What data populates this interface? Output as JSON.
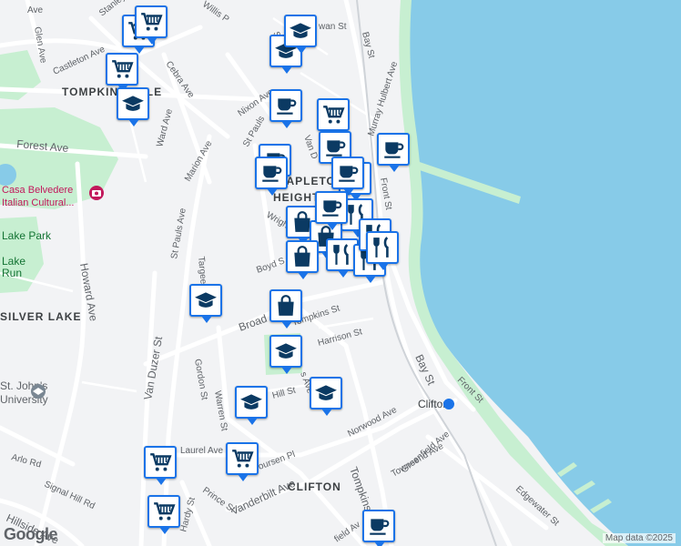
{
  "map": {
    "colors": {
      "water": "#87cbe8",
      "park": "#c7efd1",
      "shore": "#d6f1df",
      "road": "#ffffff",
      "land": "#f2f3f5",
      "marker_border": "#1a73e8",
      "marker_icon": "#0b3a63"
    },
    "places": {
      "tompkinsville": "TOMPKINSVILLE",
      "stapleton": "STAPLETON",
      "heights": "HEIGHTS",
      "silver_lake": "SILVER LAKE",
      "clifton": "CLIFTON"
    },
    "pois": {
      "casa_belvedere_1": "Casa Belvedere",
      "casa_belvedere_2": "Italian Cultural...",
      "lake_park": "Lake Park",
      "lake_run_1": "Lake",
      "lake_run_2": "Run",
      "st_johns_1": "St. John's",
      "st_johns_2": "University",
      "clifton_station": "Clifton"
    },
    "streets": {
      "ave_top": "Ave",
      "stanley": "Stanley",
      "willis": "Willis P",
      "glen": "Glen Ave",
      "castleton": "Castleton Ave",
      "cebra": "Cebra Ave",
      "bay_top": "Bay St",
      "st_top": "St",
      "wan": "wan St",
      "murray": "Murray Hulbert Ave",
      "forest": "Forest Ave",
      "nixon": "Nixon Ave",
      "st_pauls_top": "St Pauls",
      "ward": "Ward Ave",
      "marion": "Marion Ave",
      "van_dz": "Van D",
      "front_top": "Front St",
      "st_pauls_ave": "St Pauls Ave",
      "wright": "Wright",
      "boyd": "Boyd S",
      "howard": "Howard Ave",
      "van_duzer": "Van Duzer St",
      "targee": "Targee St",
      "broad": "Broad",
      "tompkins_st": "Tompkins St",
      "harrison": "Harrison St",
      "bay_mid": "Bay St",
      "gordon": "Gordon St",
      "warren": "Warren St",
      "hill": "Hill St",
      "tompkins_ave_short": "s Ave",
      "front_bottom": "Front St",
      "norwood": "Norwood Ave",
      "greenfield": "Greenfield Ave",
      "townsend": "Townsend Ave",
      "arlo": "Arlo Rd",
      "laurel": "Laurel Ave",
      "vourhees": "oursen Pl",
      "vanderbilt": "Vanderbilt Ave",
      "tompkins_ave": "Tompkins Ave",
      "signal_hill": "Signal Hill Rd",
      "prince": "Prince St",
      "hardy": "Hardy St",
      "hillside": "Hillside Ave",
      "edgewater": "Edgewater St",
      "field": "field Av"
    },
    "markers": [
      {
        "name": "shopping-cart-icon",
        "title": "grocery"
      },
      {
        "name": "coffee-cup-icon",
        "title": "cafe"
      },
      {
        "name": "shopping-bag-icon",
        "title": "shop"
      },
      {
        "name": "fork-knife-icon",
        "title": "restaurant"
      },
      {
        "name": "graduation-cap-icon",
        "title": "school"
      }
    ],
    "attribution": "Map data ©2025",
    "logo": "Google"
  }
}
